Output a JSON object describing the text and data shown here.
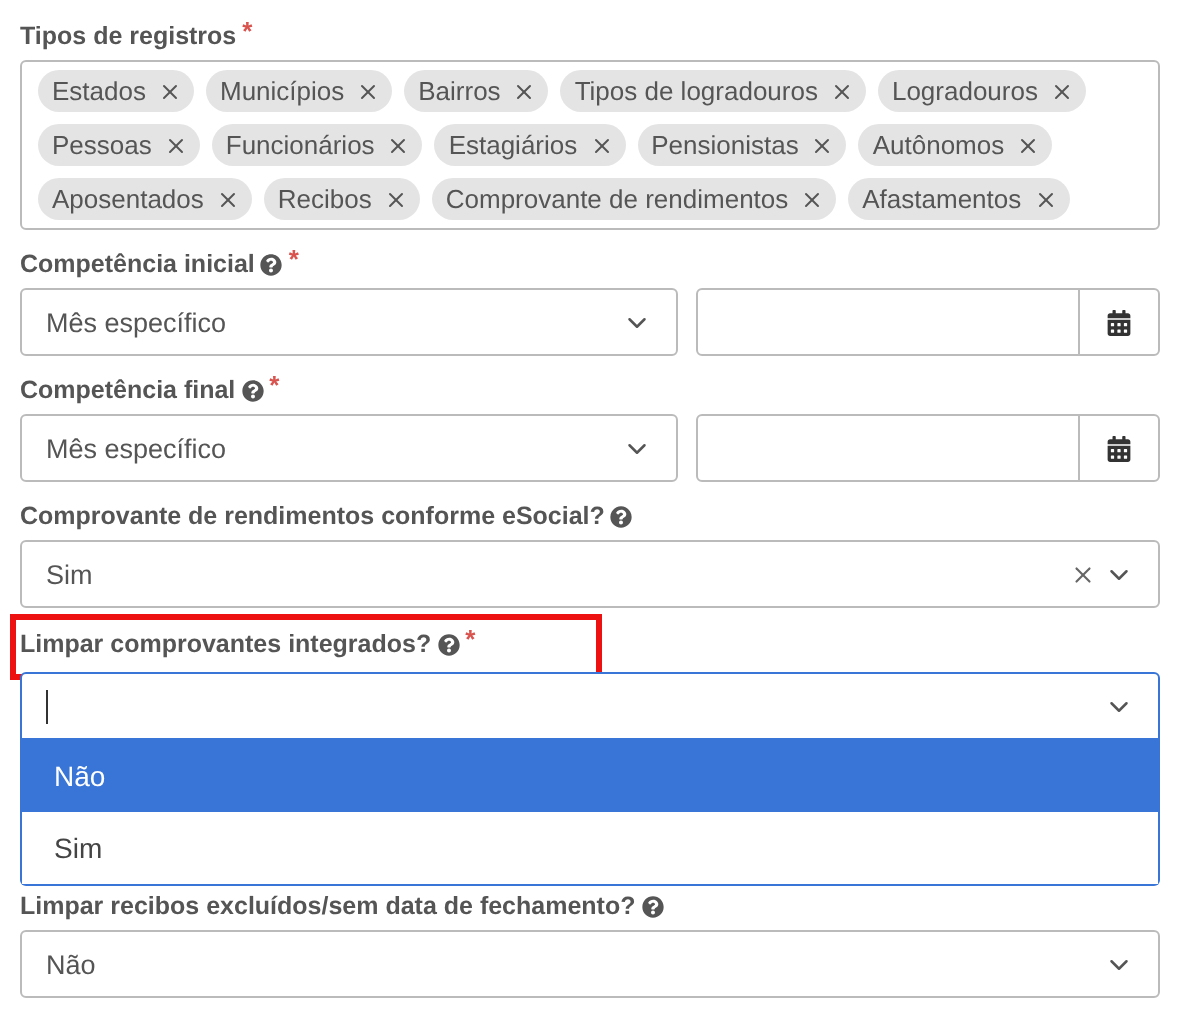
{
  "fields": [
    {
      "kind": "tags",
      "label": "Tipos de registros",
      "required_mark": "*",
      "tags": [
        "Estados",
        "Municípios",
        "Bairros",
        "Tipos de logradouros",
        "Logradouros",
        "Pessoas",
        "Funcionários",
        "Estagiários",
        "Pensionistas",
        "Autônomos",
        "Aposentados",
        "Recibos",
        "Comprovante de rendimentos",
        "Afastamentos"
      ]
    },
    {
      "kind": "period",
      "label": "Competência inicial",
      "required_mark": "*",
      "help": true,
      "value": "Mês específico"
    },
    {
      "kind": "period",
      "label": "Competência final",
      "required_mark": "*",
      "help": true,
      "value": "Mês específico"
    },
    {
      "kind": "select",
      "label": "Comprovante de rendimentos conforme eSocial?",
      "help": true,
      "value": "Sim",
      "clearable": true
    },
    {
      "kind": "open-select",
      "label": "Limpar comprovantes integrados?",
      "required_mark": "*",
      "help": true,
      "highlighted": true,
      "options": [
        {
          "label": "Não",
          "selected": true
        },
        {
          "label": "Sim",
          "selected": false
        }
      ]
    },
    {
      "kind": "select",
      "label": "Limpar recibos excluídos/sem data de fechamento?",
      "help": true,
      "value": "Não"
    }
  ]
}
